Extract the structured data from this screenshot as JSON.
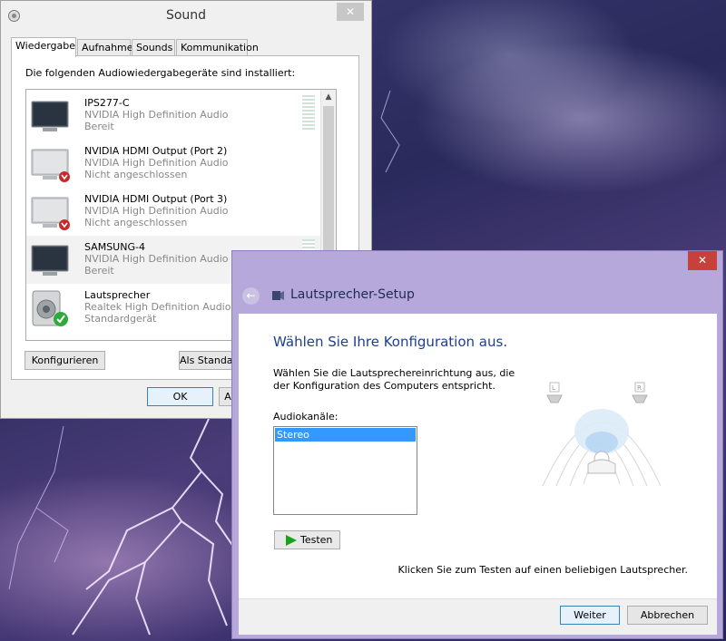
{
  "sound_dialog": {
    "title": "Sound",
    "close_icon": "close-icon",
    "tabs": [
      {
        "label": "Wiedergabe",
        "active": true
      },
      {
        "label": "Aufnahme",
        "active": false
      },
      {
        "label": "Sounds",
        "active": false
      },
      {
        "label": "Kommunikation",
        "active": false
      }
    ],
    "caption": "Die folgenden Audiowiedergabegeräte sind installiert:",
    "devices": [
      {
        "name": "IPS277-C",
        "driver": "NVIDIA High Definition Audio",
        "state": "Bereit",
        "icon": "monitor-icon"
      },
      {
        "name": "NVIDIA HDMI Output (Port 2)",
        "driver": "NVIDIA High Definition Audio",
        "state": "Nicht angeschlossen",
        "icon": "monitor-disconnected-icon"
      },
      {
        "name": "NVIDIA HDMI Output (Port 3)",
        "driver": "NVIDIA High Definition Audio",
        "state": "Nicht angeschlossen",
        "icon": "monitor-disconnected-icon"
      },
      {
        "name": "SAMSUNG-4",
        "driver": "NVIDIA High Definition Audio",
        "state": "Bereit",
        "icon": "monitor-icon"
      },
      {
        "name": "Lautsprecher",
        "driver": "Realtek High Definition Audio",
        "state": "Standardgerät",
        "icon": "speaker-default-icon"
      }
    ],
    "configure_label": "Konfigurieren",
    "set_default_label": "Als Standard",
    "ok_label": "OK",
    "partial_button_label": "A"
  },
  "setup_dialog": {
    "title": "Lautsprecher-Setup",
    "heading": "Wählen Sie Ihre Konfiguration aus.",
    "description": "Wählen Sie die Lautsprechereinrichtung aus, die der Konfiguration des Computers entspricht.",
    "channels_label": "Audiokanäle:",
    "channels": [
      "Stereo"
    ],
    "selected_channel": "Stereo",
    "test_label": "Testen",
    "hint": "Klicken Sie zum Testen auf einen beliebigen Lautsprecher.",
    "speaker_left_label": "L",
    "speaker_right_label": "R",
    "next_label": "Weiter",
    "cancel_label": "Abbrechen",
    "close_icon": "close-icon",
    "back_icon": "back-arrow-icon"
  },
  "colors": {
    "selection": "#3399ff",
    "close_red": "#c7403a",
    "setup_frame": "#b7a8dc",
    "heading_blue": "#1c3f8f"
  }
}
